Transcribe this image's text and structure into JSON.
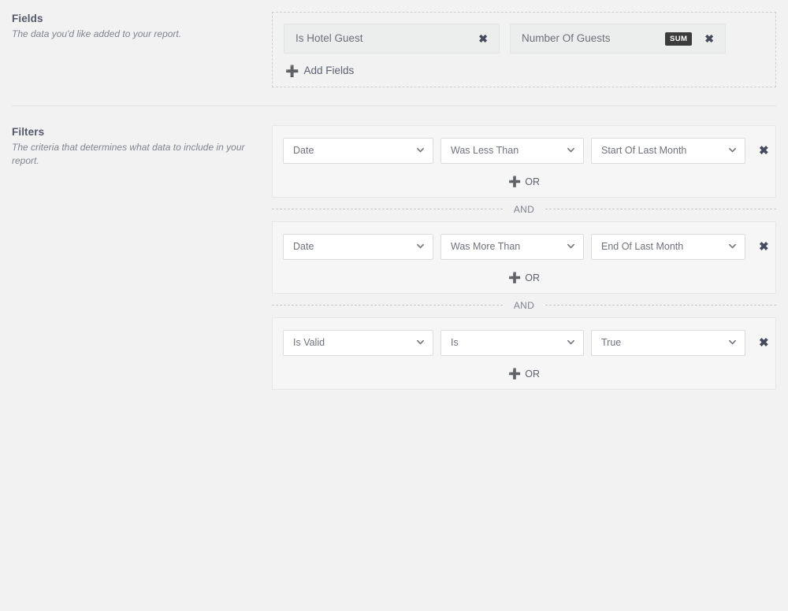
{
  "fields": {
    "title": "Fields",
    "description": "The data you'd like added to your report.",
    "chips": [
      {
        "label": "Is Hotel Guest",
        "aggregate": null,
        "remove_icon": "close-icon"
      },
      {
        "label": "Number Of Guests",
        "aggregate": "SUM",
        "remove_icon": "close-icon"
      }
    ],
    "add_label": "Add Fields",
    "add_icon": "plus-icon"
  },
  "filters": {
    "title": "Filters",
    "description": "The criteria that determines what data to include in your report.",
    "or_label": "OR",
    "or_icon": "plus-icon",
    "and_label": "AND",
    "remove_icon": "close-icon",
    "chevron_icon": "chevron-down-icon",
    "groups": [
      {
        "field": "Date",
        "operator": "Was Less Than",
        "value": "Start Of Last Month"
      },
      {
        "field": "Date",
        "operator": "Was More Than",
        "value": "End Of Last Month"
      },
      {
        "field": "Is Valid",
        "operator": "Is",
        "value": "True"
      }
    ]
  },
  "colors": {
    "page_background": "#f2f2f2",
    "panel_background": "#f6f6f6",
    "chip_background": "#eceded",
    "badge_background": "#3c3c3c",
    "badge_text": "#ffffff",
    "text": "#6f727b",
    "heading": "#55596a",
    "icon": "#454a5c",
    "border": "#dcdcdc",
    "dashed_border": "#cfcfcf"
  }
}
